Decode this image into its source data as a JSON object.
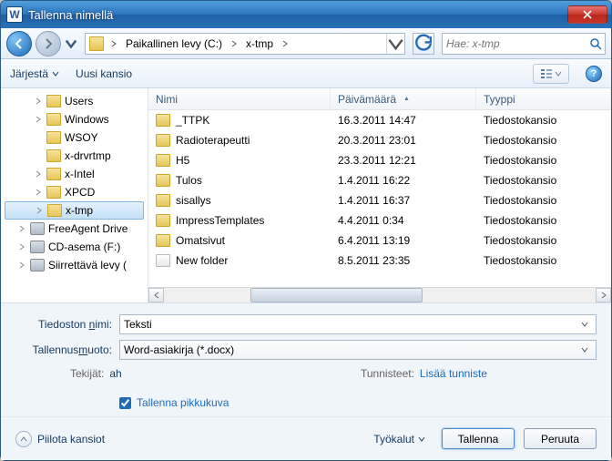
{
  "window": {
    "title": "Tallenna nimellä",
    "app_icon": "W"
  },
  "nav": {
    "crumbs": [
      "Paikallinen levy (C:)",
      "x-tmp"
    ],
    "search_placeholder": "Hae: x-tmp"
  },
  "toolbar": {
    "organize": "Järjestä",
    "newfolder": "Uusi kansio"
  },
  "tree": [
    {
      "label": "Users",
      "depth": 2,
      "exp": true,
      "icon": "folder"
    },
    {
      "label": "Windows",
      "depth": 2,
      "exp": true,
      "icon": "folder"
    },
    {
      "label": "WSOY",
      "depth": 2,
      "exp": false,
      "icon": "folder"
    },
    {
      "label": "x-drvrtmp",
      "depth": 2,
      "exp": false,
      "icon": "folder"
    },
    {
      "label": "x-Intel",
      "depth": 2,
      "exp": true,
      "icon": "folder"
    },
    {
      "label": "XPCD",
      "depth": 2,
      "exp": true,
      "icon": "folder"
    },
    {
      "label": "x-tmp",
      "depth": 2,
      "exp": true,
      "icon": "folder",
      "selected": true
    },
    {
      "label": "FreeAgent Drive",
      "depth": 1,
      "exp": true,
      "icon": "drive"
    },
    {
      "label": "CD-asema (F:)",
      "depth": 1,
      "exp": true,
      "icon": "drive"
    },
    {
      "label": "Siirrettävä levy (",
      "depth": 1,
      "exp": true,
      "icon": "drive"
    }
  ],
  "columns": {
    "name": "Nimi",
    "date": "Päivämäärä",
    "type": "Tyyppi"
  },
  "files": [
    {
      "name": "_TTPK",
      "date": "16.3.2011 14:47",
      "type": "Tiedostokansio",
      "icon": "folder"
    },
    {
      "name": "Radioterapeutti",
      "date": "20.3.2011 23:01",
      "type": "Tiedostokansio",
      "icon": "folder"
    },
    {
      "name": "H5",
      "date": "23.3.2011 12:21",
      "type": "Tiedostokansio",
      "icon": "folder"
    },
    {
      "name": "Tulos",
      "date": "1.4.2011 16:22",
      "type": "Tiedostokansio",
      "icon": "folder"
    },
    {
      "name": "sisallys",
      "date": "1.4.2011 16:37",
      "type": "Tiedostokansio",
      "icon": "folder"
    },
    {
      "name": "ImpressTemplates",
      "date": "4.4.2011 0:34",
      "type": "Tiedostokansio",
      "icon": "folder"
    },
    {
      "name": "Omatsivut",
      "date": "6.4.2011 13:19",
      "type": "Tiedostokansio",
      "icon": "folder"
    },
    {
      "name": "New folder",
      "date": "8.5.2011 23:35",
      "type": "Tiedostokansio",
      "icon": "doc"
    }
  ],
  "form": {
    "filename_label": "Tiedoston nimi:",
    "filename_value": "Teksti",
    "savetype_label": "Tallennusmuoto:",
    "savetype_value": "Word-asiakirja (*.docx)",
    "authors_label": "Tekijät:",
    "authors_value": "ah",
    "tags_label": "Tunnisteet:",
    "tags_value": "Lisää tunniste",
    "thumb_label": "Tallenna pikkukuva"
  },
  "footer": {
    "hide": "Piilota kansiot",
    "tools": "Työkalut",
    "save": "Tallenna",
    "cancel": "Peruuta"
  },
  "chart_data": {
    "type": "table",
    "note": "file listing — see files[]"
  }
}
